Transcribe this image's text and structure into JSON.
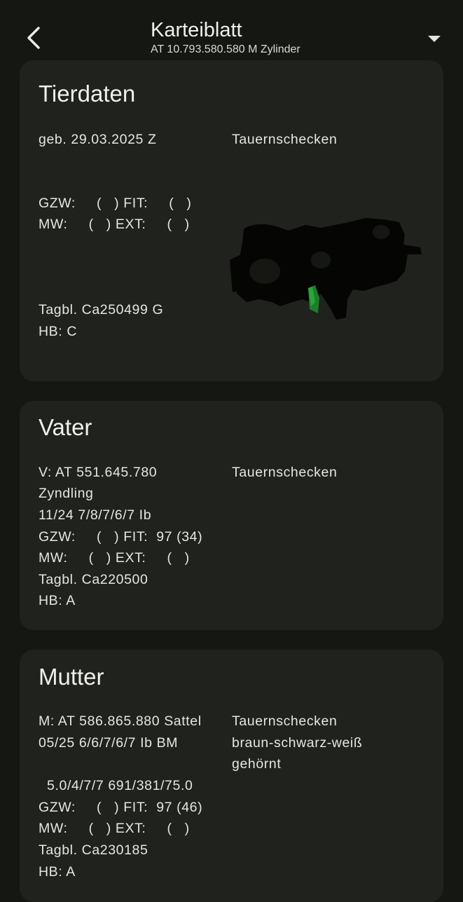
{
  "appbar": {
    "title": "Karteiblatt",
    "subtitle": "AT 10.793.580.580 M Zylinder",
    "back_icon": "chevron-left-icon",
    "menu_icon": "caret-down-icon"
  },
  "tierdaten": {
    "title": "Tierdaten",
    "birth": "geb. 29.03.2025 Z",
    "breed": "Tauernschecken",
    "gzw_fit": "GZW:     (   ) FIT:     (   )",
    "mw_ext": "MW:     (   ) EXT:     (   )",
    "tagbl": "Tagbl. Ca250499 G",
    "hb": "HB: C"
  },
  "vater": {
    "title": "Vater",
    "id": "V: AT 551.645.780",
    "breed": "Tauernschecken",
    "name": "Zyndling",
    "eval": "11/24 7/8/7/6/7 Ib",
    "gzw_fit": "GZW:     (   ) FIT:  97 (34)",
    "mw_ext": "MW:     (   ) EXT:     (   )",
    "tagbl": "Tagbl. Ca220500",
    "hb": "HB: A"
  },
  "mutter": {
    "title": "Mutter",
    "id": "M: AT 586.865.880 Sattel",
    "breed": "Tauernschecken",
    "eval": "05/25 6/6/7/6/7 Ib BM",
    "color": "braun-schwarz-weiß",
    "horn": "gehörnt",
    "measures": "  5.0/4/7/7 691/381/75.0",
    "gzw_fit": "GZW:     (   ) FIT:  97 (46)",
    "mw_ext": "MW:     (   ) EXT:     (   )",
    "tagbl": "Tagbl. Ca230185",
    "hb": "HB: A"
  },
  "colors": {
    "background": "#151713",
    "card": "#20221e",
    "text": "#e6e6e2"
  }
}
